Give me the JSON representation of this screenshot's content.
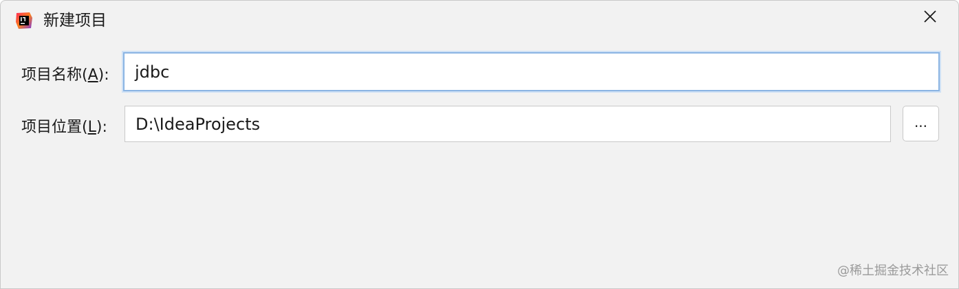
{
  "window": {
    "title": "新建项目"
  },
  "form": {
    "name_label_prefix": "项目名称(",
    "name_mnemonic": "A",
    "name_label_suffix": "):",
    "name_value": "jdbc",
    "location_label_prefix": "项目位置(",
    "location_mnemonic": "L",
    "location_label_suffix": "):",
    "location_value": "D:\\IdeaProjects",
    "browse_label": "..."
  },
  "watermark": "@稀土掘金技术社区",
  "icons": {
    "app": "intellij-idea-icon",
    "close": "close-icon"
  },
  "colors": {
    "focus_border": "#8ab4e3",
    "background": "#f2f2f2"
  }
}
